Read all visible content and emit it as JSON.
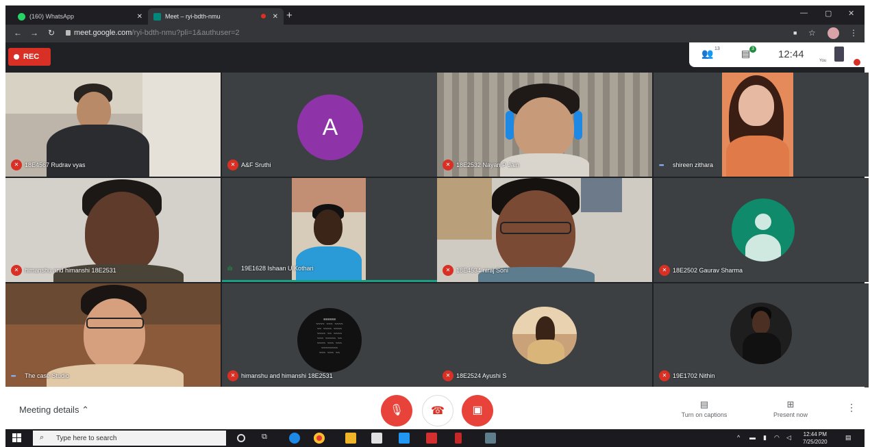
{
  "browser": {
    "tabs": [
      {
        "title": "(160) WhatsApp",
        "favicon_color": "#25d366"
      },
      {
        "title": "Meet – ryi-bdth-nmu",
        "favicon_color": "#00897b"
      }
    ],
    "new_tab_symbol": "+",
    "url_host": "meet.google.com",
    "url_path": "/ryi-bdth-nmu?pli=1&authuser=2"
  },
  "meet": {
    "rec_label": "REC",
    "participants_count": "13",
    "chat_badge": "3",
    "clock": "12:44",
    "you_label": "You",
    "tiles": [
      {
        "name": "18E4567 Rudrav vyas",
        "status": "muted",
        "kind": "video"
      },
      {
        "name": "A&F Sruthi",
        "status": "muted",
        "kind": "avatar",
        "initial": "A",
        "avatar_color": "#8e34a8"
      },
      {
        "name": "18E2532 Nayan P Jain",
        "status": "muted",
        "kind": "video"
      },
      {
        "name": "shireen zithara",
        "status": "dots",
        "kind": "video"
      },
      {
        "name": "himanshu and himanshi 18E2531",
        "status": "muted",
        "kind": "video"
      },
      {
        "name": "19E1628 Ishaan U Kothari",
        "status": "speaking",
        "kind": "video"
      },
      {
        "name": "18E4534 niraj Soni",
        "status": "muted",
        "kind": "video"
      },
      {
        "name": "18E2502 Gaurav Sharma",
        "status": "muted",
        "kind": "avatar-generic",
        "avatar_color": "#0f8a6a"
      },
      {
        "name": "The case Studio",
        "status": "dots",
        "kind": "video"
      },
      {
        "name": "himanshu and himanshi 18E2531",
        "status": "muted",
        "kind": "circle-text"
      },
      {
        "name": "18E2524 Ayushi S",
        "status": "muted",
        "kind": "circle-photo"
      },
      {
        "name": "19E1702 Nithin",
        "status": "muted",
        "kind": "dark-photo"
      }
    ]
  },
  "controls": {
    "meeting_details": "Meeting details",
    "turn_on_captions": "Turn on captions",
    "present_now": "Present now"
  },
  "taskbar": {
    "search_placeholder": "Type here to search",
    "time": "12:44 PM",
    "date": "7/25/2020"
  }
}
